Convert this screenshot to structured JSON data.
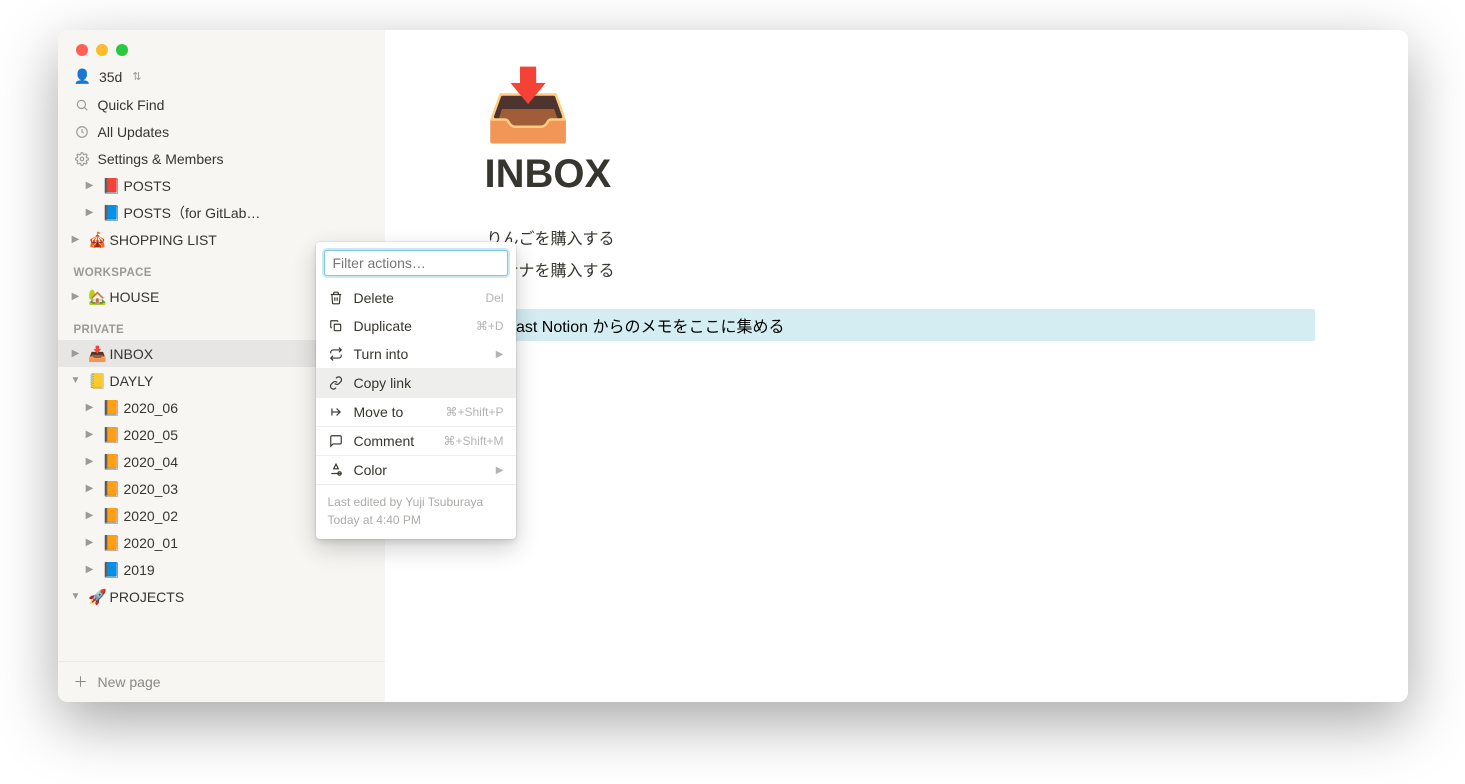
{
  "user": {
    "name": "35d"
  },
  "topmenu": {
    "quickfind": "Quick Find",
    "updates": "All Updates",
    "settings": "Settings & Members"
  },
  "sidebar": {
    "top_items": [
      {
        "emoji": "📕",
        "label": "POSTS"
      },
      {
        "emoji": "📘",
        "label": "POSTS（for GitLab…"
      },
      {
        "emoji": "🎪",
        "label": "SHOPPING LIST"
      }
    ],
    "workspace_label": "WORKSPACE",
    "workspace_items": [
      {
        "emoji": "🏡",
        "label": "HOUSE"
      }
    ],
    "private_label": "PRIVATE",
    "private_items": [
      {
        "emoji": "📥",
        "label": "INBOX",
        "active": true,
        "expanded": false,
        "depth": 0
      },
      {
        "emoji": "📒",
        "label": "DAYLY",
        "expanded": true,
        "depth": 0
      },
      {
        "emoji": "📙",
        "label": "2020_06",
        "depth": 1
      },
      {
        "emoji": "📙",
        "label": "2020_05",
        "depth": 1
      },
      {
        "emoji": "📙",
        "label": "2020_04",
        "depth": 1
      },
      {
        "emoji": "📙",
        "label": "2020_03",
        "depth": 1
      },
      {
        "emoji": "📙",
        "label": "2020_02",
        "depth": 1
      },
      {
        "emoji": "📙",
        "label": "2020_01",
        "depth": 1
      },
      {
        "emoji": "📘",
        "label": "2019",
        "depth": 1
      },
      {
        "emoji": "🚀",
        "label": "PROJECTS",
        "expanded": true,
        "depth": 0
      }
    ],
    "newpage": "New page"
  },
  "context_menu": {
    "filter_placeholder": "Filter actions…",
    "items": [
      {
        "icon": "trash",
        "label": "Delete",
        "shortcut": "Del"
      },
      {
        "icon": "duplicate",
        "label": "Duplicate",
        "shortcut": "⌘+D"
      },
      {
        "icon": "turninto",
        "label": "Turn into",
        "submenu": true
      },
      {
        "icon": "link",
        "label": "Copy link",
        "highlight": true
      },
      {
        "icon": "moveto",
        "label": "Move to",
        "shortcut": "⌘+Shift+P"
      },
      {
        "icon": "comment",
        "label": "Comment",
        "shortcut": "⌘+Shift+M"
      },
      {
        "icon": "color",
        "label": "Color",
        "submenu": true
      }
    ],
    "footer_line1": "Last edited by Yuji Tsuburaya",
    "footer_line2": "Today at 4:40 PM"
  },
  "page": {
    "icon": "📥",
    "title": "INBOX",
    "lines": [
      "りんごを購入する",
      "バナナを購入する"
    ],
    "toggle": "Fast Notion からのメモをここに集める"
  }
}
